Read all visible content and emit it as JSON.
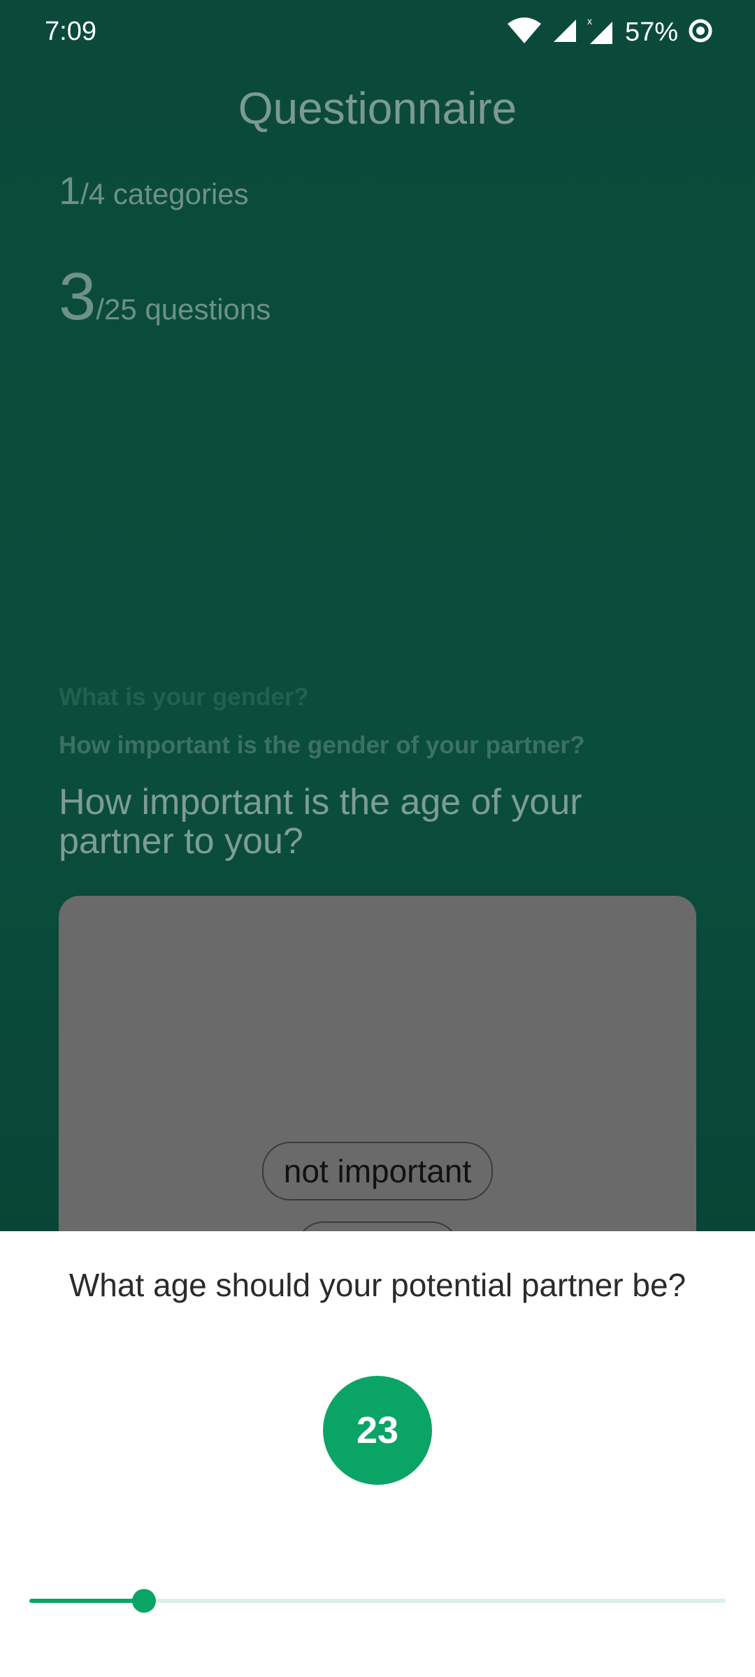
{
  "status_bar": {
    "time": "7:09",
    "battery_percent": "57%",
    "icons": [
      "wifi-icon",
      "signal-icon",
      "signal-no-service-icon",
      "battery-saver-icon"
    ]
  },
  "screen": {
    "title": "Questionnaire",
    "categories_progress": {
      "current": "1",
      "suffix": "/4 categories"
    },
    "questions_progress": {
      "current": "3",
      "suffix": "/25 questions"
    },
    "previous_questions": [
      "What is your gender?",
      "How important is the gender of your partner?"
    ],
    "current_question": "How important is the age of your partner to you?",
    "answer_options": [
      "not important"
    ]
  },
  "age_sheet": {
    "question": "What age should your potential partner be?",
    "selected_age": "23",
    "slider_fraction": 0.165,
    "accent_color": "#0aa566"
  }
}
